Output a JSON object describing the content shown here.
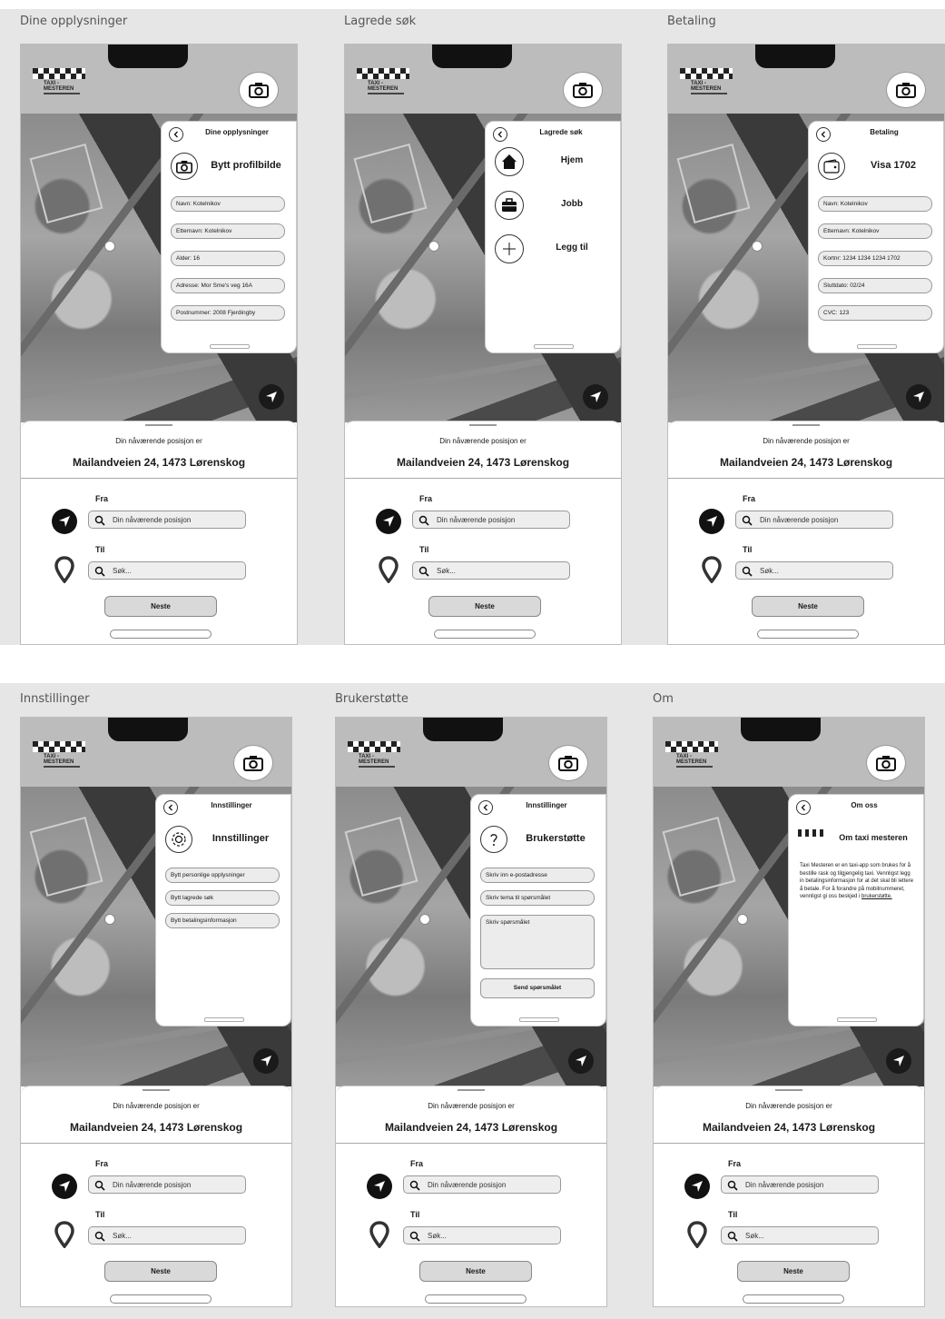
{
  "common": {
    "logo_line1": "TAXI -",
    "logo_line2": "MESTEREN",
    "position_label": "Din nåværende posisjon er",
    "position_address": "Mailandveien 24, 1473 Lørenskog",
    "from_label": "Fra",
    "from_placeholder": "Din nåværende posisjon",
    "to_label": "Til",
    "to_placeholder": "Søk...",
    "next_label": "Neste"
  },
  "frames": [
    {
      "frame_title": "Dine opplysninger",
      "panel_title": "Dine opplysninger",
      "big_label": "Bytt profilbilde",
      "fields": [
        "Navn: Kotelnikov",
        "Etternavn: Kotelnikov",
        "Alder: 16",
        "Adresse: Mor Sme's veg 16A",
        "Postnummer: 2008 Fjerdingby"
      ]
    },
    {
      "frame_title": "Lagrede søk",
      "panel_title": "Lagrede søk",
      "items": [
        "Hjem",
        "Jobb",
        "Legg til"
      ]
    },
    {
      "frame_title": "Betaling",
      "panel_title": "Betaling",
      "big_label": "Visa 1702",
      "fields": [
        "Navn: Kotelnikov",
        "Etternavn: Kotelnikov",
        "Kortnr: 1234 1234 1234 1702",
        "Sluttdato: 02/24",
        "CVC: 123"
      ]
    },
    {
      "frame_title": "Innstillinger",
      "panel_title": "Innstillinger",
      "big_label": "Innstillinger",
      "fields": [
        "Bytt personlige opplysninger",
        "Bytt lagrede søk",
        "Bytt betalingsinformasjon"
      ]
    },
    {
      "frame_title": "Brukerstøtte",
      "panel_title": "Innstillinger",
      "big_label": "Brukerstøtte",
      "fields": [
        "Skriv inn e-postadresse",
        "Skriv tema til spørsmålet"
      ],
      "textarea": "Skriv spørsmålet",
      "send_label": "Send spørsmålet"
    },
    {
      "frame_title": "Om",
      "panel_title": "Om oss",
      "big_label": "Om taxi mesteren",
      "about_text": "Taxi Mesteren er en taxi-app som brukes for å bestille rask og tilgjengelig taxi. Vennligst legg in betalingsinformasjon for at det skal bli lettere å betale. For å forandre på mobilnummeret, vennligst gi oss beskjed i",
      "about_link": "brukerstøtte."
    }
  ]
}
